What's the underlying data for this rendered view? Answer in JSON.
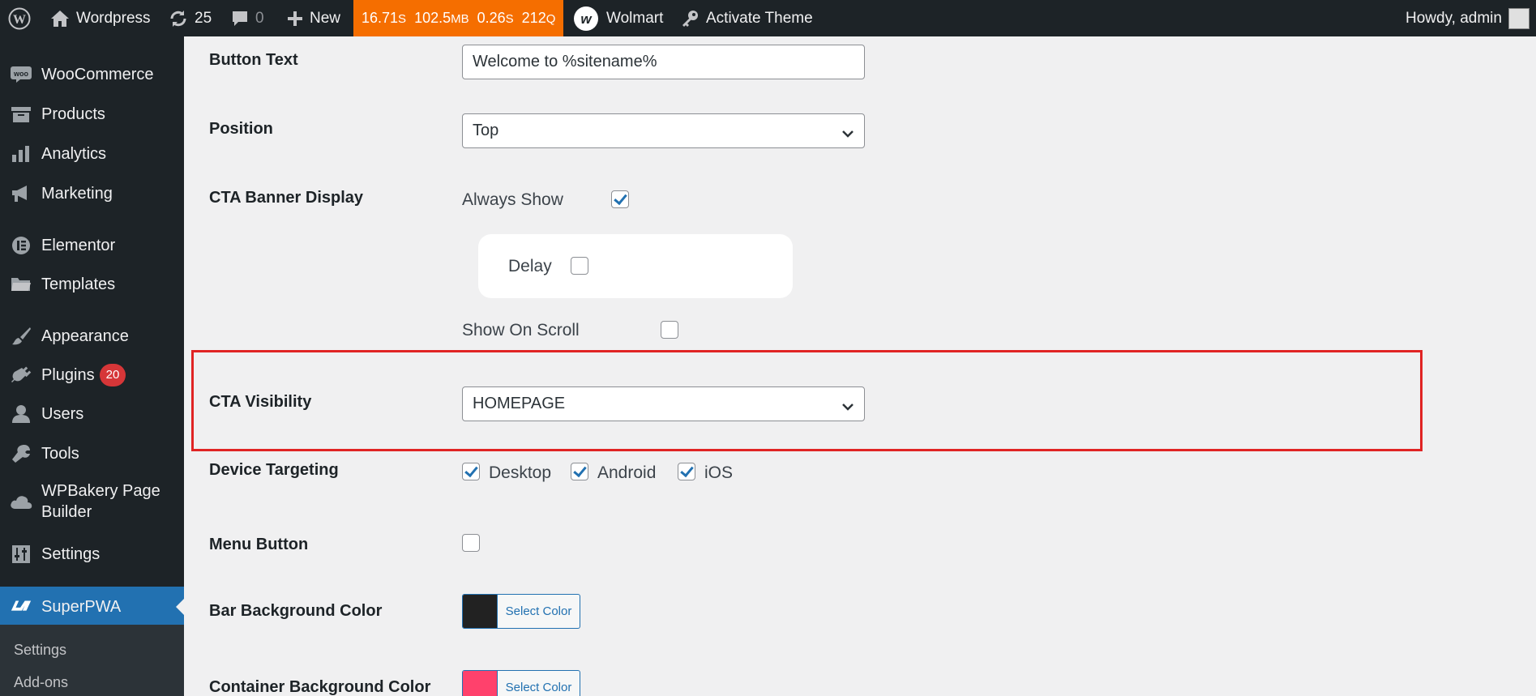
{
  "adminbar": {
    "site_name": "Wordpress",
    "updates_count": "25",
    "comments_count": "0",
    "new_label": "New",
    "qm": {
      "time": "16.71",
      "time_unit": "S",
      "memory": "102.5",
      "memory_unit": "MB",
      "db_time": "0.26",
      "db_time_unit": "S",
      "queries": "212",
      "queries_unit": "Q"
    },
    "theme_name": "Wolmart",
    "activate_theme": "Activate Theme",
    "howdy": "Howdy, admin"
  },
  "sidebar": {
    "items": [
      {
        "label": "WooCommerce",
        "icon": "woo-icon"
      },
      {
        "label": "Products",
        "icon": "archive-icon"
      },
      {
        "label": "Analytics",
        "icon": "bar-chart-icon"
      },
      {
        "label": "Marketing",
        "icon": "megaphone-icon"
      },
      {
        "label": "Elementor",
        "icon": "elementor-icon"
      },
      {
        "label": "Templates",
        "icon": "folder-icon"
      },
      {
        "label": "Appearance",
        "icon": "brush-icon"
      },
      {
        "label": "Plugins",
        "icon": "plug-icon",
        "badge": "20"
      },
      {
        "label": "Users",
        "icon": "user-icon"
      },
      {
        "label": "Tools",
        "icon": "wrench-icon"
      },
      {
        "label": "WPBakery Page",
        "label2": "Builder",
        "icon": "cloud-icon"
      },
      {
        "label": "Settings",
        "icon": "sliders-icon"
      },
      {
        "label": "SuperPWA",
        "icon": "pwa-icon",
        "active": true
      }
    ],
    "submenu": [
      {
        "label": "Settings"
      },
      {
        "label": "Add-ons"
      }
    ]
  },
  "form": {
    "button_text": {
      "label": "Button Text",
      "value": "Welcome to %sitename%"
    },
    "position": {
      "label": "Position",
      "value": "Top"
    },
    "cta_banner_display": {
      "label": "CTA Banner Display",
      "always_show": {
        "label": "Always Show",
        "checked": true
      },
      "delay": {
        "label": "Delay",
        "checked": false
      },
      "show_on_scroll": {
        "label": "Show On Scroll",
        "checked": false
      }
    },
    "cta_visibility": {
      "label": "CTA Visibility",
      "value": "HOMEPAGE"
    },
    "device_targeting": {
      "label": "Device Targeting",
      "options": [
        {
          "label": "Desktop",
          "checked": true
        },
        {
          "label": "Android",
          "checked": true
        },
        {
          "label": "iOS",
          "checked": true
        }
      ]
    },
    "menu_button": {
      "label": "Menu Button",
      "checked": false
    },
    "bar_bg_color": {
      "label": "Bar Background Color",
      "button": "Select Color",
      "color": "#222222"
    },
    "container_bg_color": {
      "label": "Container Background Color",
      "button": "Select Color",
      "color": "#ff416c"
    }
  },
  "colors": {
    "adminbar_bg": "#1d2327",
    "qm_orange": "#f56e00",
    "accent_blue": "#2271b1",
    "highlight_red": "#e02424"
  }
}
